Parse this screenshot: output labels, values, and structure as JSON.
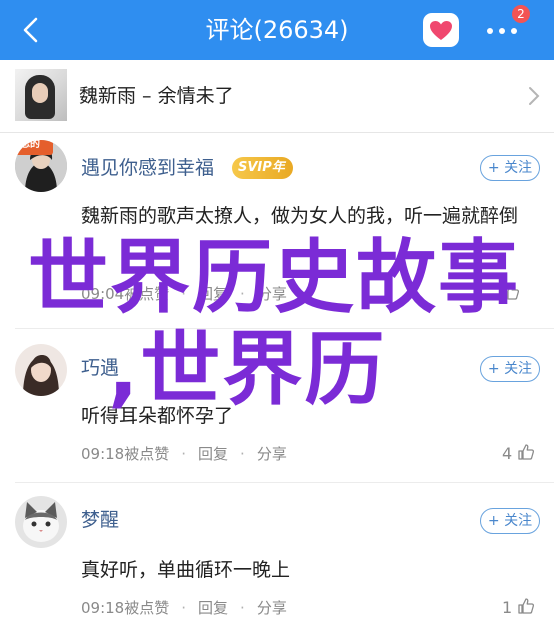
{
  "header": {
    "title": "评论(26634)",
    "badge_count": "2",
    "back_icon": "back-arrow-icon",
    "like_icon": "heart-icon",
    "more_icon": "more-dots-icon",
    "bg_color": "#2f8ef0"
  },
  "song": {
    "title": "魏新雨 – 余情未了"
  },
  "comments": [
    {
      "username": "遇见你感到幸福",
      "vip_badge": "SVIP年",
      "avatar_badge": "遗忘的",
      "follow_label": "+ 关注",
      "text": "魏新雨的歌声太撩人，做为女人的我，听一遍就醉倒",
      "time": "09:04",
      "like_label": "被点赞",
      "reply_label": "回复",
      "share_label": "分享",
      "like_count": ""
    },
    {
      "username": "巧遇",
      "follow_label": "+ 关注",
      "text": "听得耳朵都怀孕了",
      "time": "09:18",
      "like_label": "被点赞",
      "reply_label": "回复",
      "share_label": "分享",
      "like_count": "4"
    },
    {
      "username": "梦醒",
      "follow_label": "+ 关注",
      "text": "真好听，单曲循环一晚上",
      "time": "09:18",
      "like_label": "被点赞",
      "reply_label": "回复",
      "share_label": "分享",
      "like_count": "1"
    }
  ],
  "watermark": {
    "line1": "世界历史故事",
    "line2": ",世界历",
    "color": "#7b2bd6"
  }
}
